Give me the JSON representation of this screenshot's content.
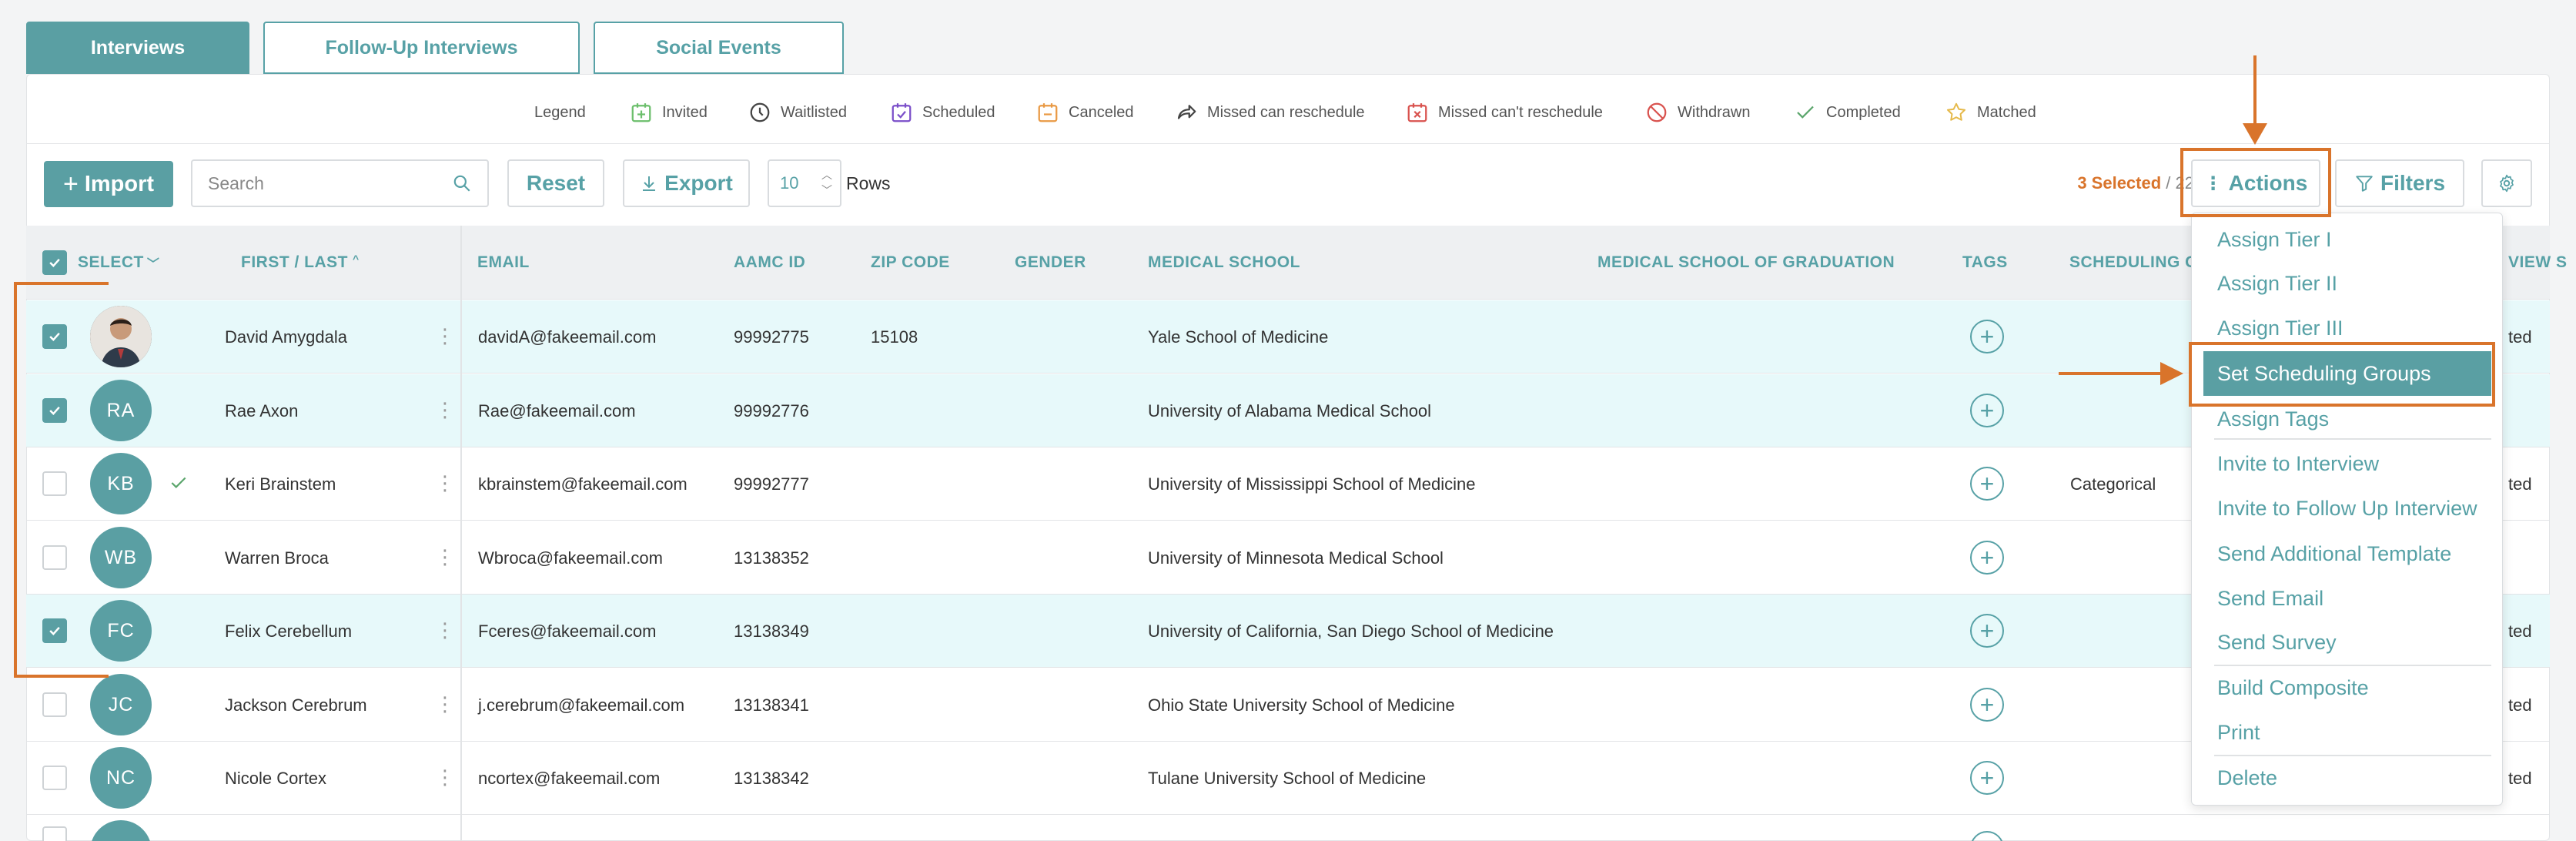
{
  "tabs": [
    {
      "label": "Interviews",
      "active": true
    },
    {
      "label": "Follow-Up Interviews",
      "active": false
    },
    {
      "label": "Social Events",
      "active": false
    }
  ],
  "legend": {
    "title": "Legend",
    "items": [
      {
        "label": "Invited",
        "icon": "calendar-plus-icon",
        "color": "#6cbf6c"
      },
      {
        "label": "Waitlisted",
        "icon": "clock-icon",
        "color": "#444444"
      },
      {
        "label": "Scheduled",
        "icon": "calendar-check-icon",
        "color": "#7b4fc9"
      },
      {
        "label": "Canceled",
        "icon": "calendar-minus-icon",
        "color": "#e99a45"
      },
      {
        "label": "Missed can reschedule",
        "icon": "share-arrow-icon",
        "color": "#444444"
      },
      {
        "label": "Missed can't reschedule",
        "icon": "calendar-x-icon",
        "color": "#d9534f"
      },
      {
        "label": "Withdrawn",
        "icon": "no-entry-icon",
        "color": "#d9534f"
      },
      {
        "label": "Completed",
        "icon": "check-icon",
        "color": "#5aa56b"
      },
      {
        "label": "Matched",
        "icon": "star-icon",
        "color": "#e5b94a"
      }
    ]
  },
  "toolbar": {
    "import_label": "Import",
    "search_placeholder": "Search",
    "reset_label": "Reset",
    "export_label": "Export",
    "rows_value": "10",
    "rows_label": "Rows",
    "selected_count": "3 Selected",
    "total_count": "/ 22",
    "actions_label": "Actions",
    "filters_label": "Filters"
  },
  "table": {
    "columns": {
      "select": "SELECT",
      "name": "FIRST / LAST",
      "email": "EMAIL",
      "aamc": "AAMC ID",
      "zip": "ZIP CODE",
      "gender": "GENDER",
      "school": "MEDICAL SCHOOL",
      "grad_school": "MEDICAL SCHOOL OF GRADUATION",
      "tags": "TAGS",
      "scheduling": "SCHEDULING G",
      "interview": "VIEW S"
    },
    "rows": [
      {
        "selected": true,
        "initials": "",
        "photo": true,
        "name": "David Amygdala",
        "email": "davidA@fakeemail.com",
        "aamc": "99992775",
        "zip": "15108",
        "school": "Yale School of Medicine",
        "scheduling": "",
        "status_tail": "ted",
        "check": false
      },
      {
        "selected": true,
        "initials": "RA",
        "photo": false,
        "name": "Rae Axon",
        "email": "Rae@fakeemail.com",
        "aamc": "99992776",
        "zip": "",
        "school": "University of Alabama Medical School",
        "scheduling": "",
        "status_tail": "",
        "check": false
      },
      {
        "selected": false,
        "initials": "KB",
        "photo": false,
        "name": "Keri Brainstem",
        "email": "kbrainstem@fakeemail.com",
        "aamc": "99992777",
        "zip": "",
        "school": "University of Mississippi School of Medicine",
        "scheduling": "Categorical",
        "status_tail": "ted",
        "check": true
      },
      {
        "selected": false,
        "initials": "WB",
        "photo": false,
        "name": "Warren Broca",
        "email": "Wbroca@fakeemail.com",
        "aamc": "13138352",
        "zip": "",
        "school": "University of Minnesota Medical School",
        "scheduling": "",
        "status_tail": "",
        "check": false
      },
      {
        "selected": true,
        "initials": "FC",
        "photo": false,
        "name": "Felix Cerebellum",
        "email": "Fceres@fakeemail.com",
        "aamc": "13138349",
        "zip": "",
        "school": "University of California, San Diego School of Medicine",
        "scheduling": "",
        "status_tail": "ted",
        "check": false
      },
      {
        "selected": false,
        "initials": "JC",
        "photo": false,
        "name": "Jackson Cerebrum",
        "email": "j.cerebrum@fakeemail.com",
        "aamc": "13138341",
        "zip": "",
        "school": "Ohio State University School of Medicine",
        "scheduling": "",
        "status_tail": "ted",
        "check": false
      },
      {
        "selected": false,
        "initials": "NC",
        "photo": false,
        "name": "Nicole Cortex",
        "email": "ncortex@fakeemail.com",
        "aamc": "13138342",
        "zip": "",
        "school": "Tulane University School of Medicine",
        "scheduling": "",
        "status_tail": "ted",
        "check": false
      }
    ]
  },
  "actions_menu": [
    {
      "label": "Assign Tier I"
    },
    {
      "label": "Assign Tier II"
    },
    {
      "label": "Assign Tier III"
    },
    {
      "label": "Set Scheduling Groups",
      "highlighted": true
    },
    {
      "label": "Assign Tags"
    },
    {
      "label": "Invite to Interview"
    },
    {
      "label": "Invite to Follow Up Interview"
    },
    {
      "label": "Send Additional Template"
    },
    {
      "label": "Send Email"
    },
    {
      "label": "Send Survey"
    },
    {
      "label": "Build Composite"
    },
    {
      "label": "Print"
    },
    {
      "label": "Delete"
    }
  ],
  "colors": {
    "accent": "#5a9fa3",
    "annotation": "#d9742b",
    "selected_row": "#e7f9fa"
  }
}
